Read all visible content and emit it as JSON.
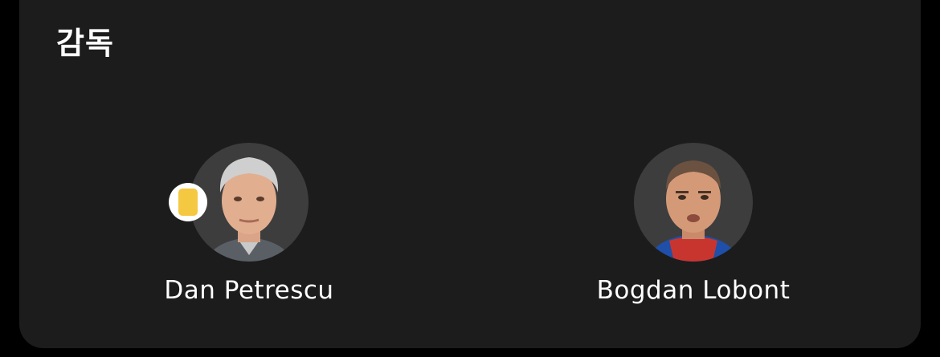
{
  "section": {
    "title": "감독"
  },
  "managers": [
    {
      "name": "Dan Petrescu",
      "avatar_icon": "manager-photo",
      "yellow_card": true,
      "card_color": "#f5c842"
    },
    {
      "name": "Bogdan Lobont",
      "avatar_icon": "manager-photo",
      "yellow_card": false
    }
  ],
  "colors": {
    "background": "#000000",
    "card": "#1c1c1c",
    "avatar_bg": "#3d3d3d",
    "text": "#ffffff"
  }
}
